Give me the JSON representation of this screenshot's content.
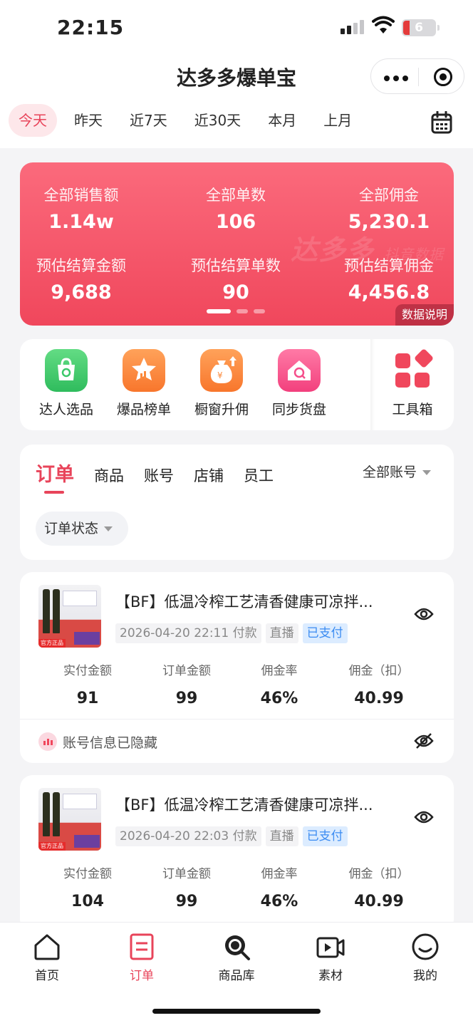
{
  "status_bar": {
    "time": "22:15",
    "battery": "6"
  },
  "header": {
    "title": "达多多爆单宝"
  },
  "date_tabs": [
    "今天",
    "昨天",
    "近7天",
    "近30天",
    "本月",
    "上月"
  ],
  "stats": {
    "row1": [
      {
        "label": "全部销售额",
        "value": "1.14w"
      },
      {
        "label": "全部单数",
        "value": "106"
      },
      {
        "label": "全部佣金",
        "value": "5,230.1"
      }
    ],
    "row2": [
      {
        "label": "预估结算金额",
        "value": "9,688"
      },
      {
        "label": "预估结算单数",
        "value": "90"
      },
      {
        "label": "预估结算佣金",
        "value": "4,456.8"
      }
    ],
    "watermark": "达多多",
    "watermark_sub": "抖音数据",
    "explain": "数据说明"
  },
  "tools": [
    {
      "label": "达人选品",
      "icon": "shopping-bag-search-icon",
      "color": "#3cc86a"
    },
    {
      "label": "爆品榜单",
      "icon": "star-chart-icon",
      "color": "#fb8a3c"
    },
    {
      "label": "橱窗升佣",
      "icon": "money-bag-up-icon",
      "color": "#fb8a3c"
    },
    {
      "label": "同步货盘",
      "icon": "home-search-icon",
      "color": "#f54d8a"
    },
    {
      "label": "工具箱",
      "icon": "toolbox-grid-icon",
      "color": "#f0475c"
    }
  ],
  "order_tabs": [
    "订单",
    "商品",
    "账号",
    "店铺",
    "员工"
  ],
  "account_filter": "全部账号",
  "status_filter": "订单状态",
  "fig_labels": [
    "实付金额",
    "订单金额",
    "佣金率",
    "佣金（扣）"
  ],
  "orders": [
    {
      "title": "【BF】低温冷榨工艺清香健康可凉拌...",
      "time": "2026-04-20 22:11 付款",
      "channel": "直播",
      "status": "已支付",
      "paid": "91",
      "amount": "99",
      "rate": "46%",
      "commission": "40.99",
      "hidden_text": "账号信息已隐藏"
    },
    {
      "title": "【BF】低温冷榨工艺清香健康可凉拌...",
      "time": "2026-04-20 22:03 付款",
      "channel": "直播",
      "status": "已支付",
      "paid": "104",
      "amount": "99",
      "rate": "46%",
      "commission": "40.99"
    }
  ],
  "thumb_tag": "官方正品",
  "bottom_nav": [
    "首页",
    "订单",
    "商品库",
    "素材",
    "我的"
  ],
  "colors": {
    "accent": "#e8445a",
    "card_red": "#f0475c",
    "paid_blue": "#3b8cf2"
  }
}
